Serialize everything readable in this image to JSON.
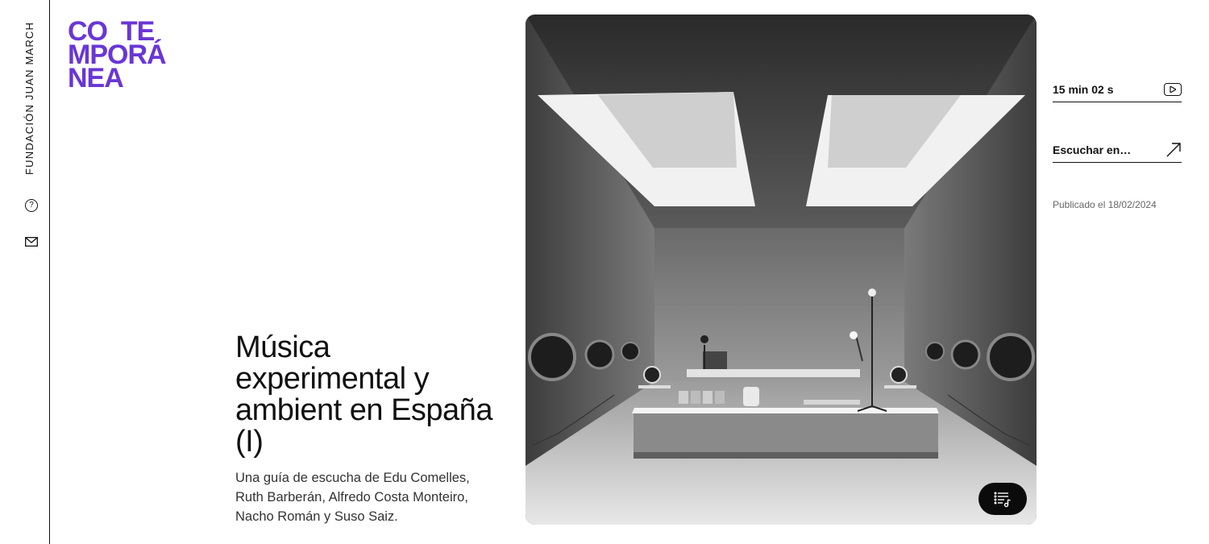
{
  "rail": {
    "brand": "FUNDACIÓN JUAN MARCH",
    "help_icon": "question-circle-icon",
    "mail_icon": "envelope-icon"
  },
  "logo": {
    "lines": [
      "CO  TE",
      "MPORÁ",
      "NEA"
    ],
    "color": "#6a36d6"
  },
  "article": {
    "title": "Música experimental y ambient en España (I)",
    "subtitle": "Una guía de escucha de Edu Comelles, Ruth Barberán, Alfredo Costa Monteiro, Nacho Román y Suso Saiz."
  },
  "media": {
    "playlist_icon": "playlist-music-icon"
  },
  "side": {
    "duration": "15 min 02 s",
    "duration_icon": "play-icon",
    "listen_label": "Escuchar en…",
    "listen_icon": "arrow-up-right-icon",
    "published": "Publicado el 18/02/2024"
  }
}
